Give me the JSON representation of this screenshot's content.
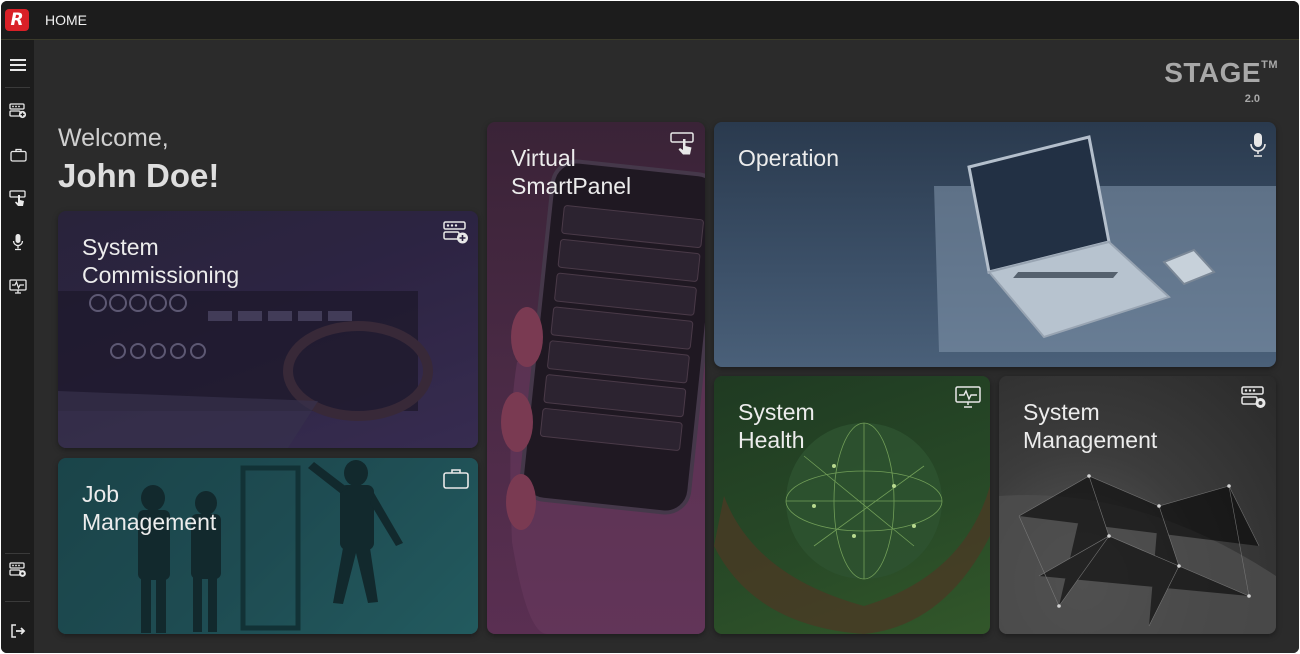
{
  "header": {
    "logo_letter": "R",
    "title": "HOME"
  },
  "sidebar": {
    "items": [
      {
        "icon": "menu-icon"
      },
      {
        "icon": "rack-add-icon"
      },
      {
        "icon": "briefcase-icon"
      },
      {
        "icon": "touch-panel-icon"
      },
      {
        "icon": "microphone-icon"
      },
      {
        "icon": "monitor-pulse-icon"
      },
      {
        "icon": "rack-settings-icon"
      },
      {
        "icon": "logout-icon"
      }
    ]
  },
  "brand": {
    "name": "STAGE",
    "trademark": "TM",
    "version": "2.0"
  },
  "welcome": {
    "greeting": "Welcome,",
    "user": "John Doe!"
  },
  "tiles": {
    "commissioning": {
      "title": "System\nCommissioning",
      "icon": "rack-add-icon"
    },
    "job": {
      "title": "Job\nManagement",
      "icon": "briefcase-icon"
    },
    "vsp": {
      "title": "Virtual\nSmartPanel",
      "icon": "touch-panel-icon"
    },
    "operation": {
      "title": "Operation",
      "icon": "microphone-icon"
    },
    "health": {
      "title": "System\nHealth",
      "icon": "monitor-pulse-icon"
    },
    "management": {
      "title": "System\nManagement",
      "icon": "rack-settings-icon"
    }
  },
  "colors": {
    "brand_red": "#d92027",
    "background": "#2b2b2b",
    "bar": "#1c1c1c"
  }
}
